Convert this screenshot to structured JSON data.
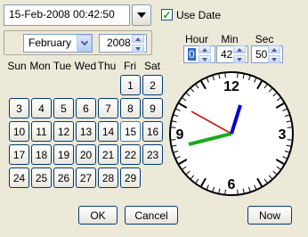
{
  "datetime_field": {
    "value": "15-Feb-2008 00:42:50"
  },
  "use_date": {
    "label": "Use Date",
    "checked": true
  },
  "calendar": {
    "month": "February",
    "year": "2008",
    "weekdays": [
      "Sun",
      "Mon",
      "Tue",
      "Wed",
      "Thu",
      "Fri",
      "Sat"
    ],
    "days": [
      "1",
      "2",
      "3",
      "4",
      "5",
      "6",
      "7",
      "8",
      "9",
      "10",
      "11",
      "12",
      "13",
      "14",
      "15",
      "16",
      "17",
      "18",
      "19",
      "20",
      "21",
      "22",
      "23",
      "24",
      "25",
      "26",
      "27",
      "28",
      "29"
    ],
    "selected_day": "15"
  },
  "time": {
    "hour_label": "Hour",
    "min_label": "Min",
    "sec_label": "Sec",
    "hour": "0",
    "min": "42",
    "sec": "50"
  },
  "clock": {
    "numerals": {
      "top": "12",
      "right": "3",
      "bottom": "6",
      "left": "9"
    },
    "hour_hand_color": "#0000cc",
    "minute_hand_color": "#1aa81a",
    "second_hand_color": "#cc0000"
  },
  "buttons": {
    "ok": "OK",
    "cancel": "Cancel",
    "now": "Now"
  }
}
